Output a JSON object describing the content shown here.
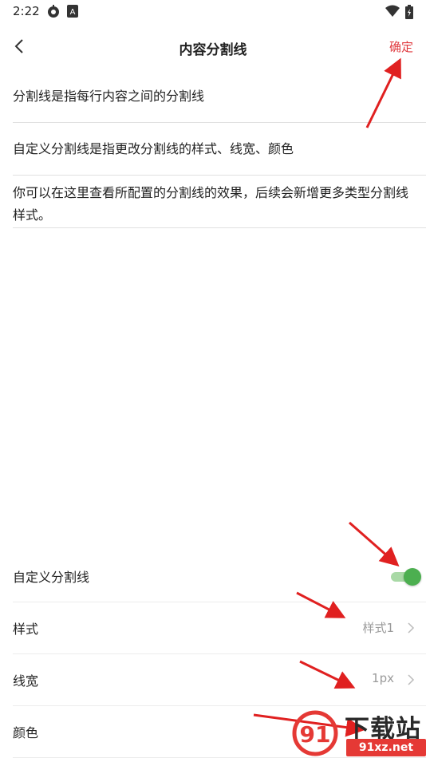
{
  "status_bar": {
    "time": "2:22",
    "icons": [
      "settings-gear-icon",
      "app-a-icon",
      "wifi-icon",
      "battery-icon"
    ]
  },
  "header": {
    "back_icon": "chevron-left-icon",
    "title": "内容分割线",
    "confirm_label": "确定",
    "confirm_color": "#e0393e"
  },
  "descriptions": [
    "分割线是指每行内容之间的分割线",
    "自定义分割线是指更改分割线的样式、线宽、颜色",
    "你可以在这里查看所配置的分割线的效果，后续会新增更多类型分割线样式。"
  ],
  "settings": {
    "custom": {
      "label": "自定义分割线",
      "enabled": true,
      "toggle_color": "#4caf50"
    },
    "style": {
      "label": "样式",
      "value": "样式1"
    },
    "width": {
      "label": "线宽",
      "value": "1px"
    },
    "color": {
      "label": "颜色"
    }
  },
  "watermark": {
    "brand_cn": "下载站",
    "brand_url": "91xz.net",
    "logo_text": "91"
  }
}
